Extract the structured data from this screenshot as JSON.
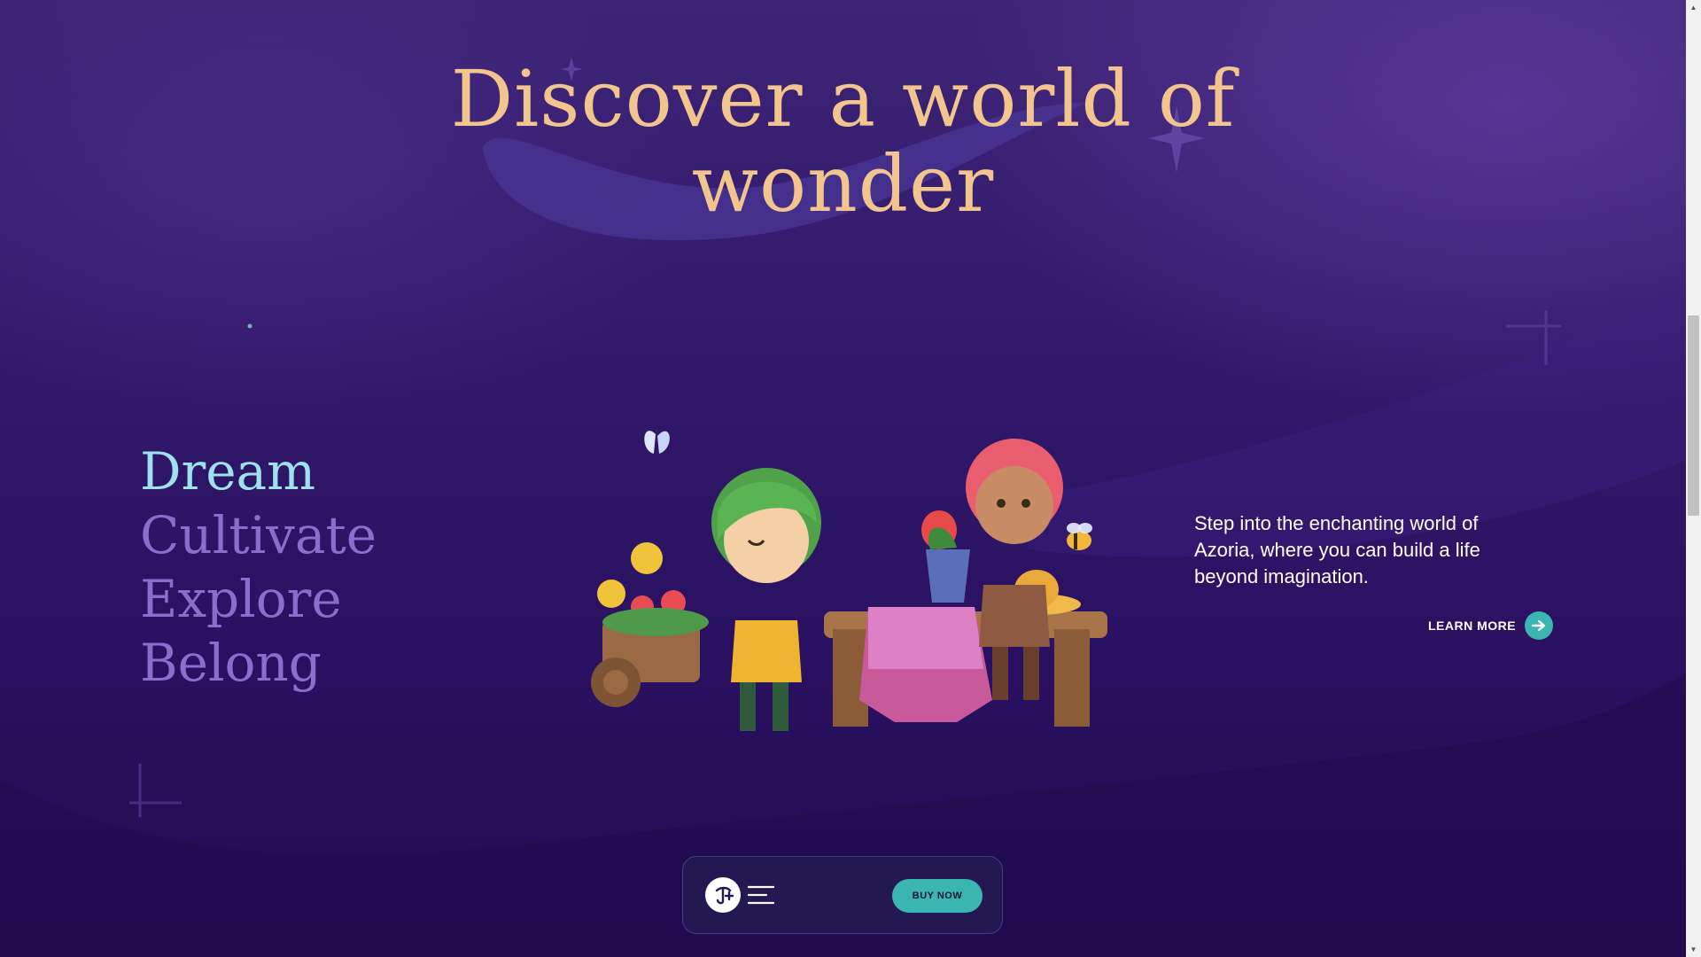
{
  "hero": {
    "title_line1": "Discover a world of",
    "title_line2": "wonder"
  },
  "features": {
    "words": [
      "Dream",
      "Cultivate",
      "Explore",
      "Belong"
    ],
    "active_index": 0
  },
  "intro": {
    "description": "Step into the enchanting world of Azoria, where you can build a life beyond imagination.",
    "learn_more_label": "LEARN MORE"
  },
  "navbar": {
    "buy_label": "BUY NOW",
    "logo_icon": "brand-logo-icon",
    "menu_icon": "hamburger-menu-icon"
  },
  "colors": {
    "background": "#2e1663",
    "headline": "#f2c58f",
    "active_word": "#9ee2ee",
    "inactive_word": "#8b6dcc",
    "accent_teal": "#3bb5b0",
    "navbar_bg": "#241853"
  }
}
